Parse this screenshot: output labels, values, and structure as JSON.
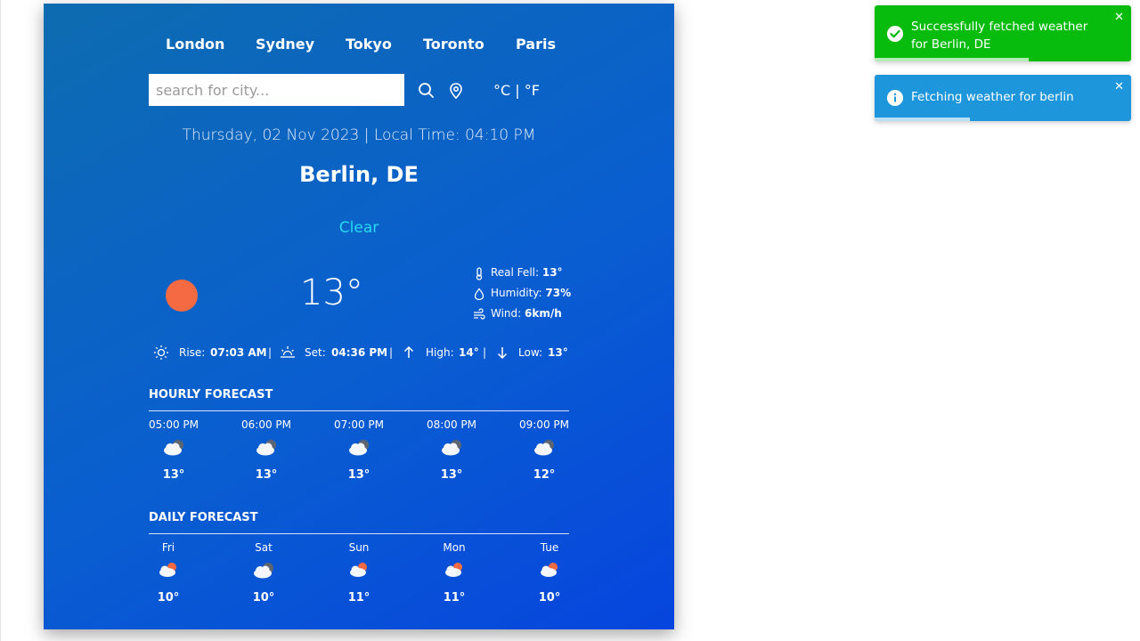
{
  "cities": [
    "London",
    "Sydney",
    "Tokyo",
    "Toronto",
    "Paris"
  ],
  "search": {
    "placeholder": "search for city..."
  },
  "units_label": "°C | °F",
  "date_line": "Thursday, 02 Nov 2023 | Local Time: 04:10 PM",
  "city_name": "Berlin, DE",
  "condition": "Clear",
  "temperature": "13°",
  "details": {
    "feels": {
      "label": "Real Fell:",
      "value": "13°"
    },
    "humidity": {
      "label": "Humidity:",
      "value": "73%"
    },
    "wind": {
      "label": "Wind:",
      "value": "6km/h"
    }
  },
  "sun": {
    "rise_label": "Rise:",
    "rise": "07:03 AM",
    "set_label": "Set:",
    "set": "04:36 PM",
    "high_label": "High:",
    "high": "14°",
    "low_label": "Low:",
    "low": "13°",
    "sep": "|"
  },
  "hourly": {
    "title": "HOURLY FORECAST",
    "items": [
      {
        "time": "05:00 PM",
        "icon": "cloudy-night-icon",
        "temp": "13°"
      },
      {
        "time": "06:00 PM",
        "icon": "cloudy-night-icon",
        "temp": "13°"
      },
      {
        "time": "07:00 PM",
        "icon": "cloudy-night-icon",
        "temp": "13°"
      },
      {
        "time": "08:00 PM",
        "icon": "cloudy-night-icon",
        "temp": "13°"
      },
      {
        "time": "09:00 PM",
        "icon": "cloudy-night-icon",
        "temp": "12°"
      }
    ]
  },
  "daily": {
    "title": "DAILY FORECAST",
    "items": [
      {
        "day": "Fri",
        "icon": "partly-cloudy-day-icon",
        "temp": "10°"
      },
      {
        "day": "Sat",
        "icon": "cloudy-night-icon",
        "temp": "10°"
      },
      {
        "day": "Sun",
        "icon": "partly-cloudy-day-icon",
        "temp": "11°"
      },
      {
        "day": "Mon",
        "icon": "partly-cloudy-day-icon",
        "temp": "11°"
      },
      {
        "day": "Tue",
        "icon": "partly-cloudy-day-icon",
        "temp": "10°"
      }
    ]
  },
  "toasts": {
    "success": {
      "message": "Successfully fetched weather for Berlin, DE",
      "color": "#07bc0c",
      "progress": 0.6
    },
    "info": {
      "message": "Fetching weather for berlin",
      "color": "#1d96dc",
      "progress": 0.37
    },
    "close": "✕"
  },
  "colors": {
    "accent": "#26d8f2",
    "sun": "#f56a43"
  }
}
